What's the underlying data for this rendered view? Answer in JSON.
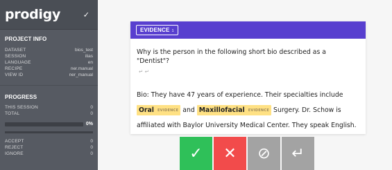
{
  "sidebar": {
    "brand": "prodigy",
    "project_info_title": "PROJECT INFO",
    "info": [
      {
        "key": "DATASET",
        "value": "bios_test"
      },
      {
        "key": "SESSION",
        "value": "ilias"
      },
      {
        "key": "LANGUAGE",
        "value": "en"
      },
      {
        "key": "RECIPE",
        "value": "ner.manual"
      },
      {
        "key": "VIEW ID",
        "value": "ner_manual"
      }
    ],
    "progress_title": "PROGRESS",
    "progress": [
      {
        "key": "THIS SESSION",
        "value": "0"
      },
      {
        "key": "TOTAL",
        "value": "0"
      }
    ],
    "progress_percent_label": "0%",
    "progress_fraction": 0,
    "counts": [
      {
        "key": "ACCEPT",
        "value": "0"
      },
      {
        "key": "REJECT",
        "value": "0"
      },
      {
        "key": "IGNORE",
        "value": "0"
      }
    ]
  },
  "card": {
    "label": "EVIDENCE",
    "label_key": "1",
    "question": "Why is the person in the following short bio described as a \"Dentist\"?",
    "newline_marks": "↵ ↵",
    "bio_segments": [
      {
        "type": "text",
        "text": "Bio:  They have 47 years of experience. Their specialties include "
      },
      {
        "type": "entity",
        "text": "Oral",
        "tag": "EVIDENCE"
      },
      {
        "type": "text",
        "text": " and "
      },
      {
        "type": "entity",
        "text": "Maxillofacial",
        "tag": "EVIDENCE"
      },
      {
        "type": "text",
        "text": " Surgery. Dr. Schow is affiliated with Baylor University Medical Center. They speak English."
      }
    ]
  },
  "actions": {
    "accept_icon": "✓",
    "reject_icon": "✕",
    "ignore_icon": "⊘",
    "undo_icon": "↵"
  },
  "colors": {
    "accent": "#583fcf",
    "sidebar": "#565a62",
    "accept": "#2fc059",
    "reject": "#f24b4b",
    "ignore": "#a3a3a3",
    "entity_highlight": "#ffe184"
  }
}
